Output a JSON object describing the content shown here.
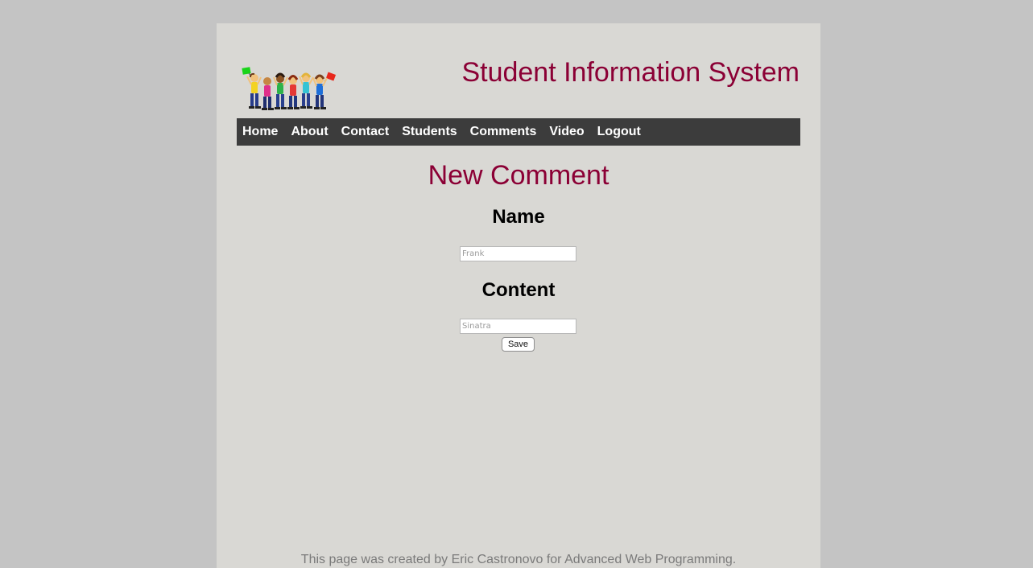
{
  "header": {
    "site_title": "Student Information System",
    "logo_icon": "jumping-students-illustration"
  },
  "nav": {
    "items": [
      {
        "label": "Home"
      },
      {
        "label": "About"
      },
      {
        "label": "Contact"
      },
      {
        "label": "Students"
      },
      {
        "label": "Comments"
      },
      {
        "label": "Video"
      },
      {
        "label": "Logout"
      }
    ],
    "background": "#3c3c3c"
  },
  "form": {
    "heading": "New Comment",
    "name_label": "Name",
    "name_placeholder": "Frank",
    "name_value": "",
    "content_label": "Content",
    "content_placeholder": "Sinatra",
    "content_value": "",
    "save_label": "Save"
  },
  "footer": {
    "text": "This page was created by Eric Castronovo for Advanced Web Programming."
  },
  "colors": {
    "accent": "#8b0035",
    "page_background": "#d9d8d4",
    "outer_background": "#c4c4c4"
  }
}
